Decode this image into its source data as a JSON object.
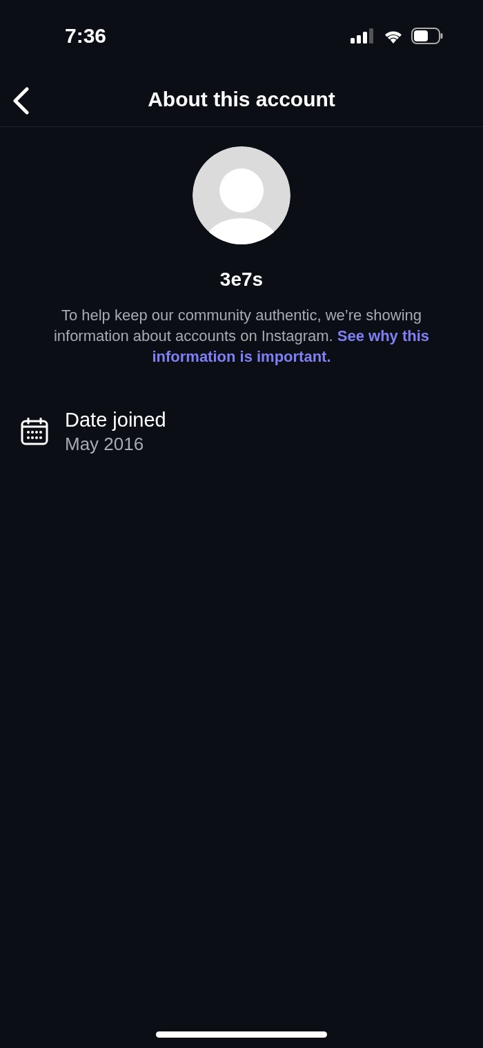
{
  "status_bar": {
    "time": "7:36"
  },
  "header": {
    "title": "About this account"
  },
  "profile": {
    "username": "3e7s",
    "description": "To help keep our community authentic, we’re showing information about accounts on Instagram.",
    "link": "See why this information is important."
  },
  "details": [
    {
      "label": "Date joined",
      "value": "May 2016"
    }
  ]
}
